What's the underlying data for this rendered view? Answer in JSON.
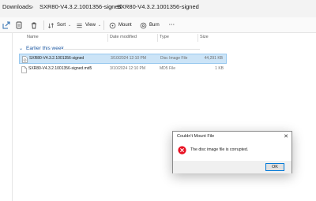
{
  "breadcrumb": {
    "items": [
      "Downloads",
      "SXR80-V4.3.2.1001356-signed",
      "SXR80-V4.3.2.1001356-signed"
    ],
    "separator": "›"
  },
  "toolbar": {
    "sort_label": "Sort",
    "view_label": "View",
    "mount_label": "Mount",
    "burn_label": "Burn",
    "more_label": "···"
  },
  "columns": {
    "name": "Name",
    "date_modified": "Date modified",
    "type": "Type",
    "size": "Size"
  },
  "group": {
    "label": "Earlier this week",
    "chevron": "⌄"
  },
  "files": [
    {
      "name": "SXR80-V4.3.2.1001356-signed",
      "date": "3/10/2024 12:10 PM",
      "type": "Disc Image File",
      "size": "44,291 KB",
      "selected": true,
      "icon": "disc-image-file-icon"
    },
    {
      "name": "SXR80-V4.3.2.1001356-signed.md5",
      "date": "3/10/2024 12:10 PM",
      "type": "MD5 File",
      "size": "1 KB",
      "selected": false,
      "icon": "document-file-icon"
    }
  ],
  "dialog": {
    "title": "Couldn't Mount File",
    "close_glyph": "✕",
    "message": "The disc image file is corrupted.",
    "ok_label": "OK",
    "icon": "error-icon"
  },
  "colors": {
    "accent": "#0078d7",
    "selection": "#cce4f7",
    "group_text": "#1f5aa3",
    "error_red": "#e81123"
  }
}
